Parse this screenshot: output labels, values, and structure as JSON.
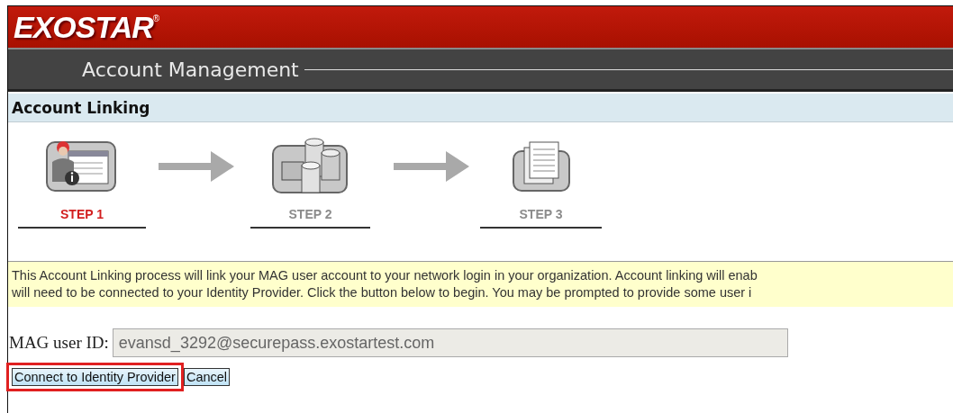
{
  "header": {
    "logo": "EXOSTAR",
    "logo_mark": "®",
    "subtitle": "Account Management"
  },
  "section_title": "Account Linking",
  "steps": [
    {
      "label": "STEP 1",
      "selected": true
    },
    {
      "label": "STEP 2",
      "selected": false
    },
    {
      "label": "STEP 3",
      "selected": false
    }
  ],
  "notice_lines": [
    "This Account Linking process will link your MAG user account to your network login in your organization. Account linking will enab",
    "will need to be connected to your Identity Provider. Click the button below to begin. You may be prompted to provide some user i"
  ],
  "user_id": {
    "label": "MAG user ID:",
    "value": "evansd_3292@securepass.exostartest.com",
    "disabled": true
  },
  "buttons": [
    {
      "label": "Connect to Identity Provider",
      "highlighted": true
    },
    {
      "label": "Cancel",
      "highlighted": false
    }
  ]
}
